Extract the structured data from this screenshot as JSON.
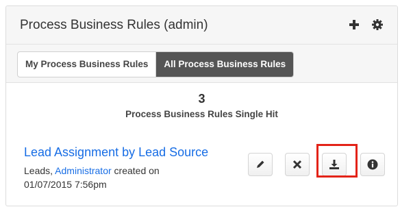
{
  "dashlet": {
    "title": "Process Business Rules (admin)",
    "add_icon": "plus-icon",
    "settings_icon": "gear-icon"
  },
  "tabs": [
    {
      "label": "My Process Business Rules",
      "active": false
    },
    {
      "label": "All Process Business Rules",
      "active": true
    }
  ],
  "summary": {
    "count": "3",
    "label": "Process Business Rules Single Hit"
  },
  "record": {
    "title": "Lead Assignment by Lead Source",
    "module": "Leads,",
    "user": "Administrator",
    "created_text": "created on",
    "date": "01/07/2015 7:56pm"
  },
  "actions": [
    {
      "icon": "pencil-icon"
    },
    {
      "icon": "close-icon"
    },
    {
      "icon": "download-icon",
      "highlighted": true
    },
    {
      "icon": "info-icon"
    }
  ],
  "colors": {
    "link": "#176de5",
    "active_tab": "#555555",
    "highlight": "#e32318"
  }
}
